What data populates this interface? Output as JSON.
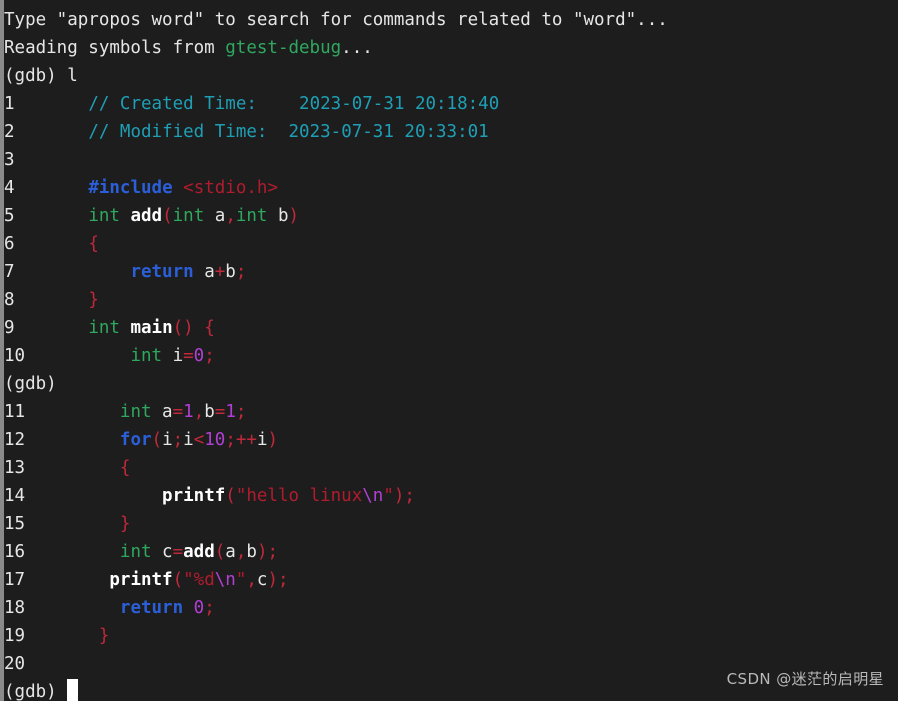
{
  "terminal": {
    "background_color": "#1d1d1d",
    "foreground_color": "#e6e6e6",
    "border_color": "#8a8a8a",
    "cursor_color": "#ffffff",
    "prompt": "(gdb)",
    "binary_name": "gtest-debug"
  },
  "palette": {
    "comment": "#1f9fb5",
    "preprocessor": "#2b5fd9",
    "header_name": "#b01c2e",
    "type": "#2fa85f",
    "function_name": "#ffffff",
    "punctuation": "#c0293b",
    "keyword": "#2b5fd9",
    "number": "#b13fd4",
    "string": "#b01c2e",
    "escape": "#b13fd4"
  },
  "header": {
    "apropos_hint": "Type \"apropos word\" to search for commands related to \"word\"...",
    "reading_prefix": "Reading symbols from ",
    "reading_symbol": "gtest-debug",
    "reading_suffix": "...",
    "first_prompt": "(gdb) ",
    "first_command": "l"
  },
  "code_lines": [
    {
      "num": "1",
      "text": "// Created Time:    2023-07-31 20:18:40"
    },
    {
      "num": "2",
      "text": "// Modified Time:  2023-07-31 20:33:01"
    },
    {
      "num": "3",
      "text": ""
    },
    {
      "num": "4",
      "text": "#include <stdio.h>"
    },
    {
      "num": "5",
      "text": "int add(int a,int b)"
    },
    {
      "num": "6",
      "text": "{"
    },
    {
      "num": "7",
      "text": "    return a+b;"
    },
    {
      "num": "8",
      "text": "}"
    },
    {
      "num": "9",
      "text": "int main() {"
    },
    {
      "num": "10",
      "text": "    int i=0;"
    },
    {
      "num": "11",
      "text": "    int a=1,b=1;"
    },
    {
      "num": "12",
      "text": "    for(i;i<10;++i)"
    },
    {
      "num": "13",
      "text": "    {"
    },
    {
      "num": "14",
      "text": "        printf(\"hello linux\\n\");"
    },
    {
      "num": "15",
      "text": "    }"
    },
    {
      "num": "16",
      "text": "    int c=add(a,b);"
    },
    {
      "num": "17",
      "text": "    printf(\"%d\\n\",c);"
    },
    {
      "num": "18",
      "text": "    return 0;"
    },
    {
      "num": "19",
      "text": "}"
    },
    {
      "num": "20",
      "text": ""
    }
  ],
  "prompts": {
    "middle_prompt": "(gdb)",
    "final_prompt": "(gdb) "
  },
  "comments": {
    "created_label": "// Created Time:",
    "created_value": "2023-07-31 20:18:40",
    "modified_label": "// Modified Time:",
    "modified_value": "2023-07-31 20:33:01"
  },
  "tokens": {
    "include_directive": "#include",
    "stdio_header": "<stdio.h>",
    "int_kw": "int",
    "add_fn": "add",
    "main_fn": "main",
    "printf_fn": "printf",
    "return_kw": "return",
    "for_kw": "for",
    "hello_string": "\"hello linux",
    "hello_escape": "\\n",
    "hello_string_end": "\"",
    "fmt_string": "\"%d",
    "fmt_escape": "\\n",
    "fmt_string_end": "\"",
    "num_zero": "0",
    "num_one_a": "1",
    "num_one_b": "1",
    "num_ten": "10",
    "num_ret_zero": "0"
  },
  "watermark": {
    "text": "CSDN @迷茫的启明星"
  }
}
